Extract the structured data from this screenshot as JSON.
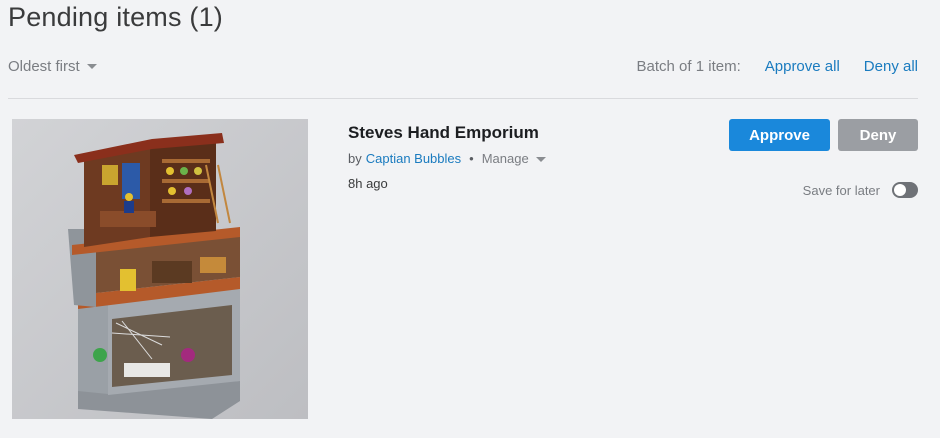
{
  "page": {
    "title": "Pending items (1)"
  },
  "toolbar": {
    "sort_label": "Oldest first",
    "batch_label": "Batch of 1 item:",
    "approve_all": "Approve all",
    "deny_all": "Deny all"
  },
  "item": {
    "title": "Steves Hand Emporium",
    "by_prefix": "by",
    "author": "Captian Bubbles",
    "separator": "•",
    "manage_label": "Manage",
    "time": "8h ago",
    "image_description": "",
    "approve_label": "Approve",
    "deny_label": "Deny",
    "save_for_later_label": "Save for later",
    "save_for_later_on": false
  },
  "colors": {
    "background": "#f2f3f5",
    "link": "#1a7bbf",
    "approve_button": "#1a88db",
    "deny_button": "#9b9ea3",
    "toggle_off": "#6f7277"
  },
  "icons": {
    "sort_caret": "chevron-down-icon",
    "manage_caret": "chevron-down-icon"
  }
}
